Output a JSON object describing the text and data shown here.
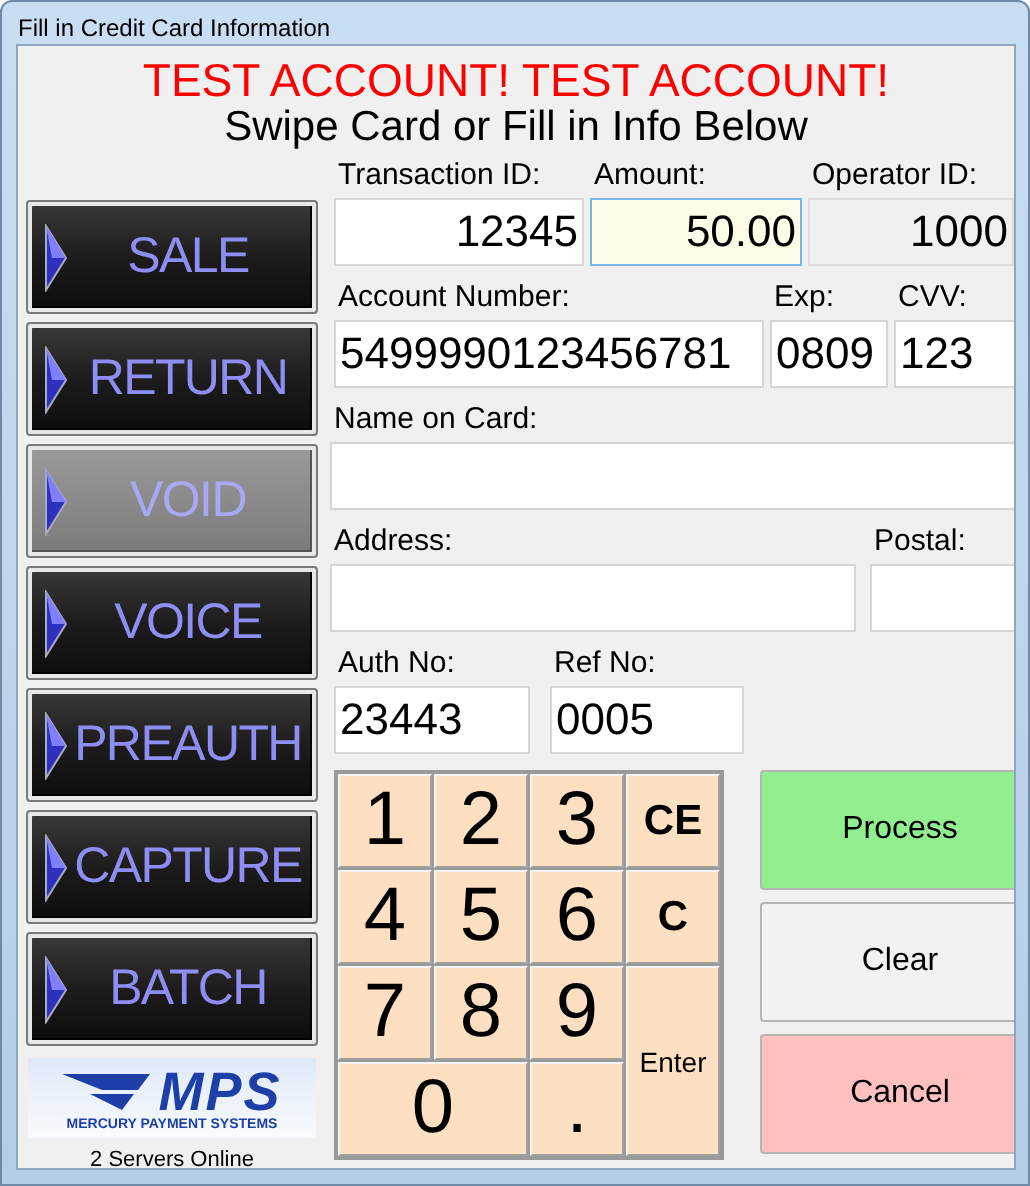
{
  "window": {
    "title": "Fill in Credit Card Information"
  },
  "banner": "TEST ACCOUNT! TEST ACCOUNT!",
  "instruction": "Swipe Card or Fill in Info Below",
  "transaction_types": [
    {
      "label": "SALE",
      "disabled": false
    },
    {
      "label": "RETURN",
      "disabled": false
    },
    {
      "label": "VOID",
      "disabled": true
    },
    {
      "label": "VOICE",
      "disabled": false
    },
    {
      "label": "PREAUTH",
      "disabled": false
    },
    {
      "label": "CAPTURE",
      "disabled": false
    },
    {
      "label": "BATCH",
      "disabled": false
    }
  ],
  "logo": {
    "mark": "MPS",
    "tagline": "MERCURY PAYMENT SYSTEMS"
  },
  "server_status": "2 Servers Online",
  "field_rows": [
    [
      {
        "label": "Transaction ID:",
        "value": "12345",
        "focused": false,
        "disabled": false
      },
      {
        "label": "Amount:",
        "value": "50.00",
        "focused": true,
        "disabled": false
      },
      {
        "label": "Operator ID:",
        "value": "1000",
        "focused": false,
        "disabled": true
      }
    ],
    [
      {
        "label": "Account Number:",
        "value": "5499990123456781",
        "focused": false,
        "disabled": false
      },
      {
        "label": "Exp:",
        "value": "0809",
        "focused": false,
        "disabled": false
      },
      {
        "label": "CVV:",
        "value": "123",
        "focused": false,
        "disabled": false
      }
    ],
    [
      {
        "label": "Name on Card:",
        "focused": false,
        "disabled": false
      }
    ],
    [
      {
        "label": "Address:",
        "focused": false,
        "disabled": false
      },
      {
        "label": "Postal:",
        "focused": false,
        "disabled": false
      }
    ],
    [
      {
        "label": "Auth No:",
        "value": "23443",
        "focused": false,
        "disabled": false
      },
      {
        "label": "Ref No:",
        "value": "0005",
        "focused": false,
        "disabled": false
      }
    ]
  ],
  "keypad": [
    {
      "label": "1",
      "kind": "digit"
    },
    {
      "label": "2",
      "kind": "digit"
    },
    {
      "label": "3",
      "kind": "digit"
    },
    {
      "label": "CE",
      "kind": "command"
    },
    {
      "label": "4",
      "kind": "digit"
    },
    {
      "label": "5",
      "kind": "digit"
    },
    {
      "label": "6",
      "kind": "digit"
    },
    {
      "label": "C",
      "kind": "command"
    },
    {
      "label": "7",
      "kind": "digit"
    },
    {
      "label": "8",
      "kind": "digit"
    },
    {
      "label": "9",
      "kind": "digit"
    },
    {
      "label": "Enter",
      "kind": "enter"
    },
    {
      "label": "0",
      "kind": "wide"
    },
    {
      "label": ".",
      "kind": "digit"
    }
  ],
  "actions": [
    {
      "label": "Process",
      "kind": "process"
    },
    {
      "label": "Clear",
      "kind": "clear"
    },
    {
      "label": "Cancel",
      "kind": "cancel"
    }
  ]
}
